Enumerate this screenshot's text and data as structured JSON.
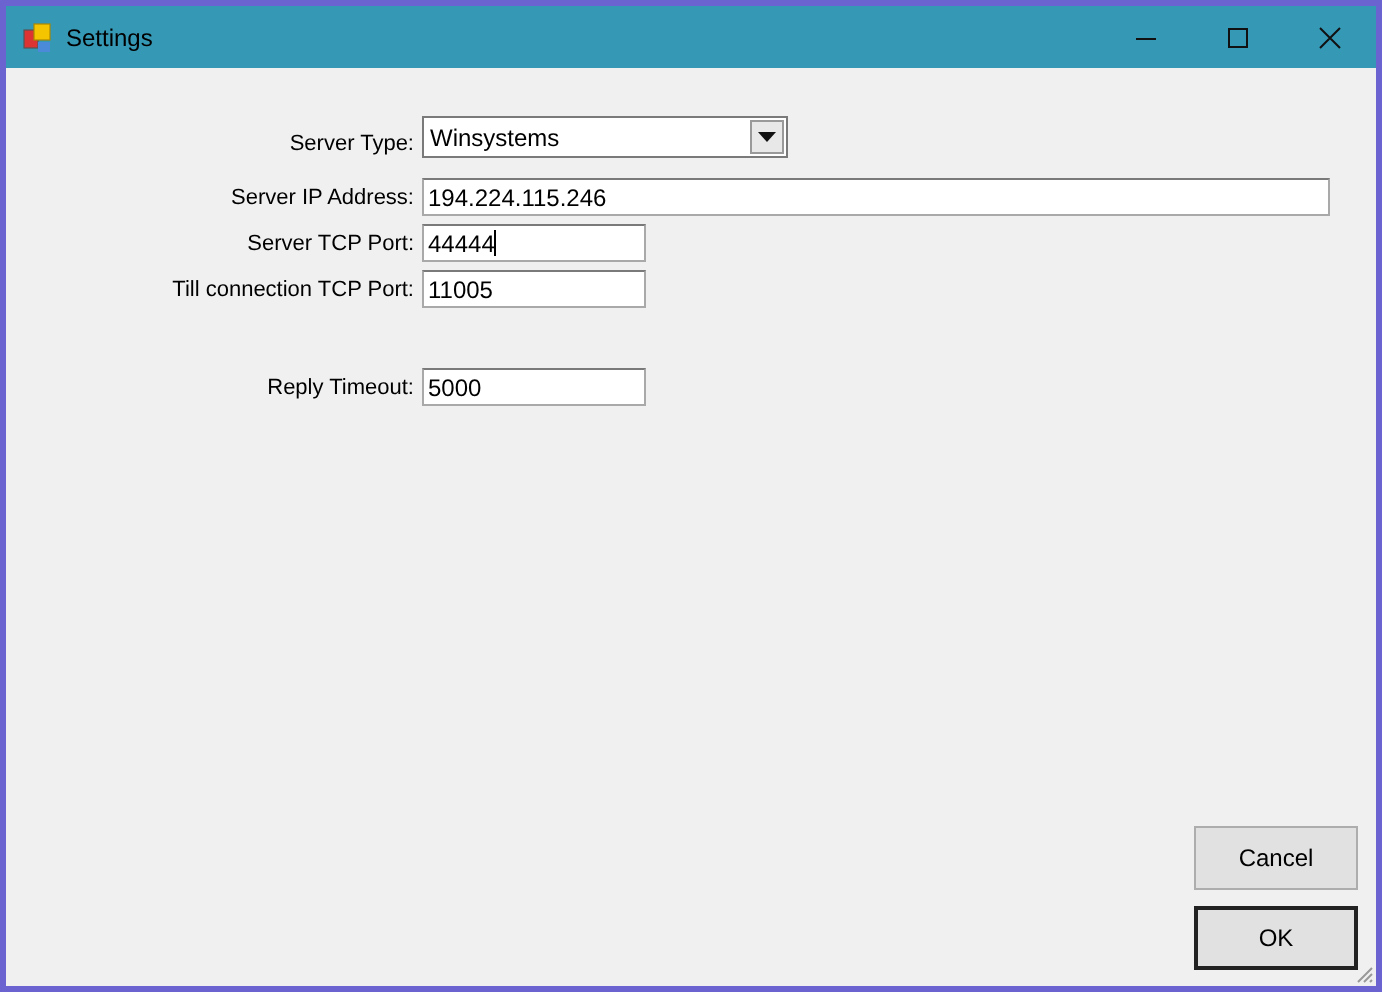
{
  "window": {
    "title": "Settings"
  },
  "groups": [
    [
      {
        "label": "Server Type:",
        "kind": "dropdown",
        "value": "Winsystems"
      },
      {
        "label": "Server IP Address:",
        "kind": "address",
        "value": "194.224.115.246",
        "focused": false
      },
      {
        "label": "Server TCP Port:",
        "kind": "number",
        "value": "44444",
        "focused": true
      },
      {
        "label": "Till connection TCP Port:",
        "kind": "number",
        "value": "11005",
        "focused": false
      }
    ],
    [
      {
        "label": "Reply Timeout:",
        "kind": "number",
        "value": "5000",
        "focused": false
      }
    ]
  ],
  "buttons": [
    {
      "label": "Cancel",
      "default": false
    },
    {
      "label": "OK",
      "default": true
    }
  ]
}
